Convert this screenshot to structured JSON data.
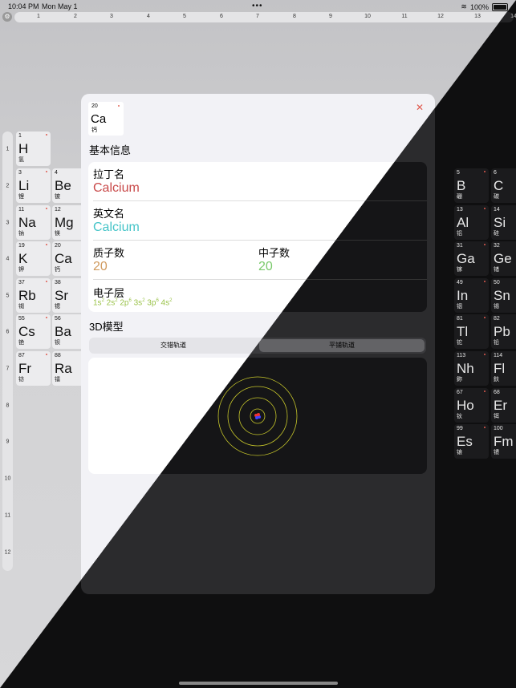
{
  "status_bar": {
    "time": "10:04 PM",
    "date": "Mon May 1",
    "battery": "100%"
  },
  "column_numbers": [
    "1",
    "2",
    "3",
    "4",
    "5",
    "6",
    "7",
    "8",
    "9",
    "10",
    "11",
    "12",
    "13",
    "14"
  ],
  "row_numbers": [
    "1",
    "2",
    "3",
    "4",
    "5",
    "6",
    "7",
    "8",
    "9",
    "10",
    "11",
    "12"
  ],
  "elements": [
    {
      "num": "1",
      "sym": "H",
      "cn": "氢"
    },
    {
      "num": "3",
      "sym": "Li",
      "cn": "锂"
    },
    {
      "num": "4",
      "sym": "Be",
      "cn": "铍"
    },
    {
      "num": "11",
      "sym": "Na",
      "cn": "钠"
    },
    {
      "num": "12",
      "sym": "Mg",
      "cn": "镁"
    },
    {
      "num": "19",
      "sym": "K",
      "cn": "钾"
    },
    {
      "num": "20",
      "sym": "Ca",
      "cn": "钙"
    },
    {
      "num": "37",
      "sym": "Rb",
      "cn": "铷"
    },
    {
      "num": "38",
      "sym": "Sr",
      "cn": "锶"
    },
    {
      "num": "55",
      "sym": "Cs",
      "cn": "铯"
    },
    {
      "num": "56",
      "sym": "Ba",
      "cn": "钡"
    },
    {
      "num": "87",
      "sym": "Fr",
      "cn": "钫"
    },
    {
      "num": "88",
      "sym": "Ra",
      "cn": "镭"
    },
    {
      "num": "5",
      "sym": "B",
      "cn": "硼"
    },
    {
      "num": "6",
      "sym": "C",
      "cn": "碳"
    },
    {
      "num": "13",
      "sym": "Al",
      "cn": "铝"
    },
    {
      "num": "14",
      "sym": "Si",
      "cn": "硅"
    },
    {
      "num": "31",
      "sym": "Ga",
      "cn": "镓"
    },
    {
      "num": "32",
      "sym": "Ge",
      "cn": "锗"
    },
    {
      "num": "49",
      "sym": "In",
      "cn": "铟"
    },
    {
      "num": "50",
      "sym": "Sn",
      "cn": "锡"
    },
    {
      "num": "81",
      "sym": "Tl",
      "cn": "铊"
    },
    {
      "num": "82",
      "sym": "Pb",
      "cn": "铅"
    },
    {
      "num": "113",
      "sym": "Nh",
      "cn": "鉨"
    },
    {
      "num": "114",
      "sym": "Fl",
      "cn": "鈇"
    },
    {
      "num": "67",
      "sym": "Ho",
      "cn": "钬"
    },
    {
      "num": "68",
      "sym": "Er",
      "cn": "铒"
    },
    {
      "num": "99",
      "sym": "Es",
      "cn": "锿"
    },
    {
      "num": "100",
      "sym": "Fm",
      "cn": "镄"
    }
  ],
  "detail": {
    "atomic_number": "20",
    "symbol": "Ca",
    "chinese_name": "钙",
    "basic_info_heading": "基本信息",
    "latin_label": "拉丁名",
    "latin_value": "Calcium",
    "english_label": "英文名",
    "english_value": "Calcium",
    "protons_label": "质子数",
    "protons_value": "20",
    "neutrons_label": "中子数",
    "neutrons_value": "20",
    "shell_label": "电子层",
    "electron_config": [
      {
        "base": "1s",
        "sup": "2"
      },
      {
        "base": "2s",
        "sup": "2"
      },
      {
        "base": "2p",
        "sup": "6"
      },
      {
        "base": "3s",
        "sup": "2"
      },
      {
        "base": "3p",
        "sup": "6"
      },
      {
        "base": "4s",
        "sup": "2"
      }
    ],
    "model_heading": "3D模型",
    "segment_options": [
      "交错轨道",
      "平铺轨道"
    ],
    "segment_selected": "平铺轨道"
  },
  "colors": {
    "latin_value": "#c94a4a",
    "english_value": "#45c4c8",
    "protons_value": "#d09a5e",
    "neutrons_value": "#79c96a",
    "electron_config": "#9bc34a",
    "close_icon": "#e05a4e",
    "orbit": "#c7c72a"
  }
}
